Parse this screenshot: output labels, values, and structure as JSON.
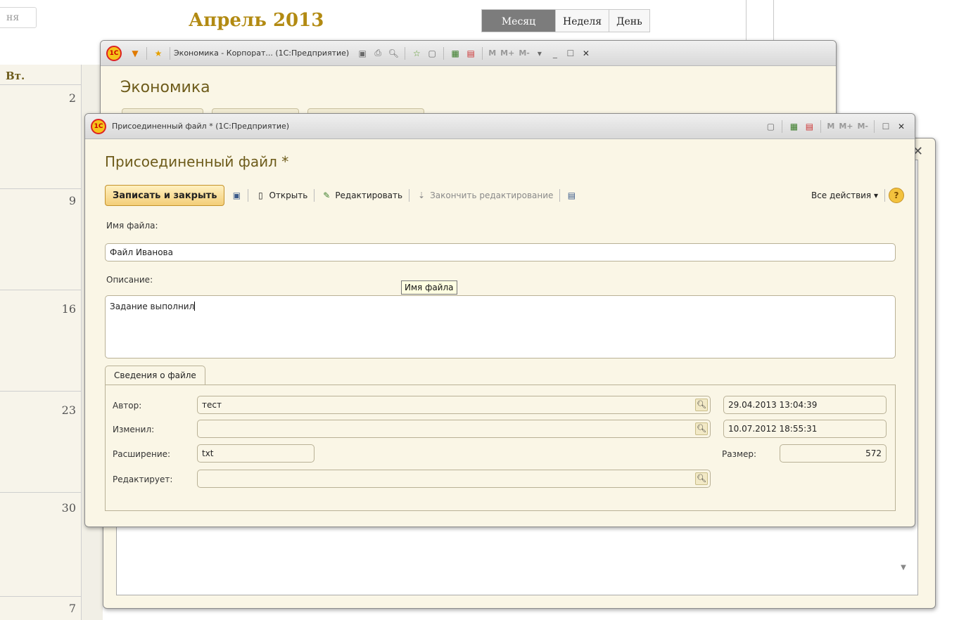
{
  "calendar": {
    "search_placeholder": "ня",
    "title": "Апрель 2013",
    "view_tabs": [
      "Месяц",
      "Неделя",
      "День"
    ],
    "weekday": "Вт.",
    "days": [
      "2",
      "9",
      "16",
      "23",
      "30",
      "7"
    ]
  },
  "econ_window": {
    "title": "Экономика - Корпорат... (1С:Предприятие)",
    "form_title": "Экономика",
    "mem_buttons": [
      "M",
      "M+",
      "M-"
    ]
  },
  "main_window": {
    "title": "Присоединенный файл * (1С:Предприятие)",
    "form_title": "Присоединенный файл *",
    "mem_buttons": [
      "M",
      "M+",
      "M-"
    ],
    "toolbar": {
      "save_close": "Записать и закрыть",
      "open": "Открыть",
      "edit": "Редактировать",
      "finish_edit": "Закончить редактирование",
      "all_actions": "Все действия ▾",
      "help": "?"
    },
    "filename_label": "Имя файла:",
    "filename_value": "Файл Иванова",
    "description_label": "Описание:",
    "description_value": "Задание выполнил",
    "tooltip": "Имя файла",
    "group_tab": "Сведения о файле",
    "author_label": "Автор:",
    "author_value": "тест",
    "author_date": "29.04.2013 13:04:39",
    "changed_label": "Изменил:",
    "changed_value": "",
    "changed_date": "10.07.2012 18:55:31",
    "ext_label": "Расширение:",
    "ext_value": "txt",
    "size_label": "Размер:",
    "size_value": "572",
    "editor_label": "Редактирует:",
    "editor_value": ""
  }
}
